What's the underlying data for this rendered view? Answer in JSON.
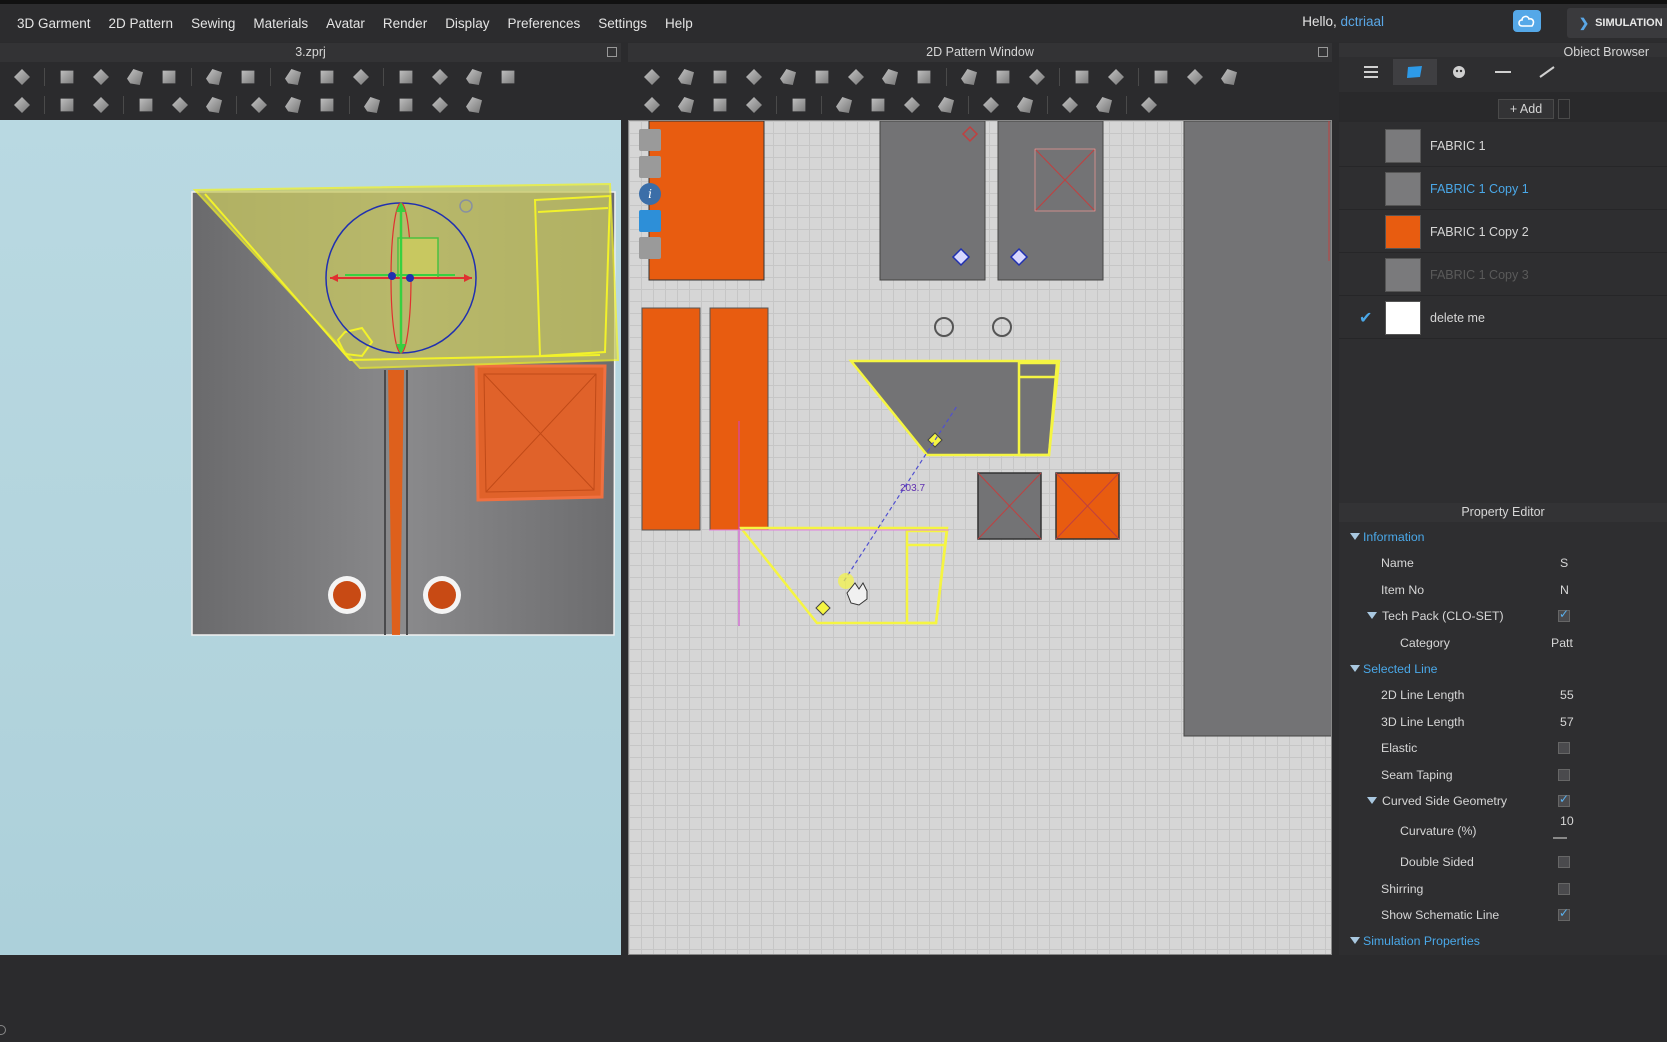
{
  "menu": {
    "items": [
      "3D Garment",
      "2D Pattern",
      "Sewing",
      "Materials",
      "Avatar",
      "Render",
      "Display",
      "Preferences",
      "Settings",
      "Help"
    ],
    "greeting": "Hello, ",
    "username": "dctriaal",
    "simulation_label": "SIMULATION"
  },
  "panels": {
    "view3d_title": "3.zprj",
    "view2d_title": "2D Pattern Window",
    "object_browser_title": "Object Browser",
    "property_editor_title": "Property Editor"
  },
  "pattern": {
    "measurement": "203.7"
  },
  "object_browser": {
    "add_label": "Add",
    "fabrics": [
      {
        "name": "FABRIC 1",
        "color": "#7a7a7c",
        "state": "normal"
      },
      {
        "name": "FABRIC 1 Copy 1",
        "color": "#7a7a7c",
        "state": "selected"
      },
      {
        "name": "FABRIC 1 Copy 2",
        "color": "#e85c10",
        "state": "normal"
      },
      {
        "name": "FABRIC 1 Copy 3",
        "color": "#7a7a7c",
        "state": "dim"
      },
      {
        "name": "delete me",
        "color": "#ffffff",
        "state": "checked"
      }
    ]
  },
  "property_editor": {
    "information": "Information",
    "name_label": "Name",
    "name_value": "S",
    "item_no_label": "Item No",
    "item_no_value": "N",
    "tech_pack_label": "Tech Pack (CLO-SET)",
    "category_label": "Category",
    "category_value": "Patt",
    "selected_line": "Selected Line",
    "line2d_label": "2D Line Length",
    "line2d_value": "55",
    "line3d_label": "3D Line Length",
    "line3d_value": "57",
    "elastic_label": "Elastic",
    "seam_taping_label": "Seam Taping",
    "curved_label": "Curved Side Geometry",
    "curvature_label": "Curvature (%)",
    "curvature_value": "10",
    "double_sided_label": "Double Sided",
    "shirring_label": "Shirring",
    "schematic_label": "Show Schematic Line",
    "simulation_properties": "Simulation Properties"
  },
  "colors": {
    "accent": "#4aa8e8",
    "orange": "#e85c10",
    "fabric_gray": "#7a7a7c",
    "highlight": "#f5f542"
  }
}
